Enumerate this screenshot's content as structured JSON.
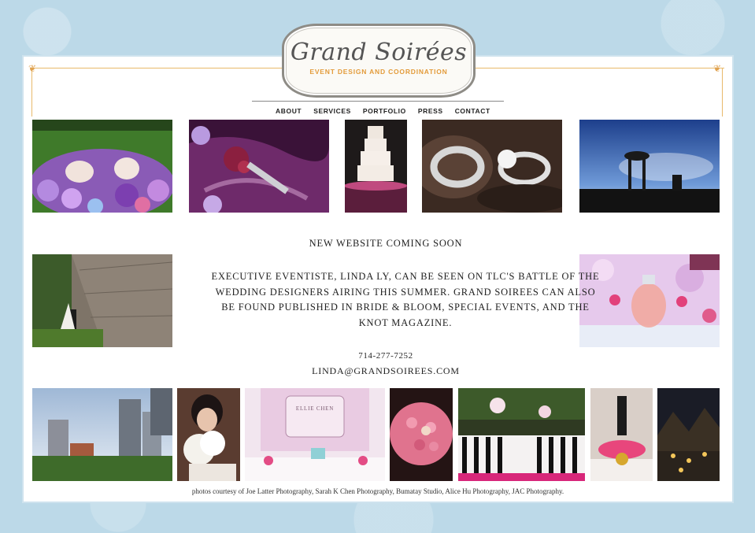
{
  "brand": {
    "name": "Grand Soirées",
    "tagline": "EVENT DESIGN AND COORDINATION"
  },
  "nav": {
    "items": [
      "ABOUT",
      "SERVICES",
      "PORTFOLIO",
      "PRESS",
      "CONTACT"
    ]
  },
  "main": {
    "headline": "NEW WEBSITE COMING SOON",
    "body": "EXECUTIVE EVENTISTE, LINDA LY, CAN BE SEEN ON TLC'S BATTLE OF THE WEDDING DESIGNERS AIRING THIS SUMMER. GRAND SOIREES CAN ALSO BE FOUND PUBLISHED IN BRIDE & BLOOM, SPECIAL EVENTS, AND THE KNOT MAGAZINE.",
    "phone": "714-277-7252",
    "email": "LINDA@GRANDSOIREES.COM"
  },
  "credits": "photos courtesy of Joe Latter Photography, Sarah K Chen Photography, Bumatay Studio, Alice Hu Photography, JAC Photography.",
  "photos": {
    "sign_text": "ELLIE CHEN"
  },
  "colors": {
    "background": "#bcd9e8",
    "accent": "#e39b3a",
    "frame": "#e8b96a"
  }
}
